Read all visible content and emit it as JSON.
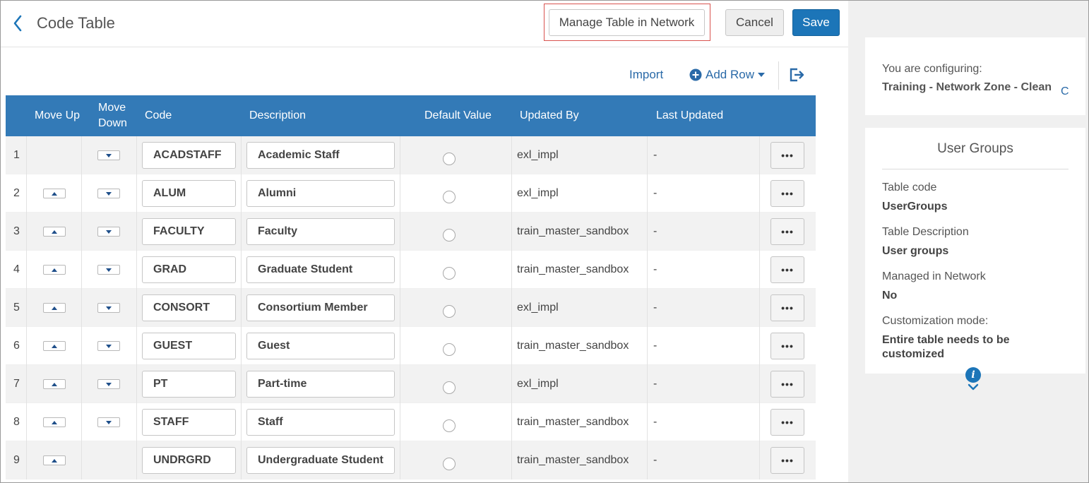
{
  "header": {
    "title": "Code Table",
    "manage_label": "Manage Table in Network",
    "cancel_label": "Cancel",
    "save_label": "Save"
  },
  "toolbar": {
    "import_label": "Import",
    "add_row_label": "Add Row"
  },
  "table": {
    "headers": {
      "move_up": "Move Up",
      "move_down_1": "Move",
      "move_down_2": "Down",
      "code": "Code",
      "description": "Description",
      "default_value": "Default Value",
      "updated_by": "Updated By",
      "last_updated": "Last Updated"
    },
    "rows": [
      {
        "num": "1",
        "code": "ACADSTAFF",
        "description": "Academic Staff",
        "updated_by": "exl_impl",
        "last_updated": "-",
        "up": false,
        "down": true
      },
      {
        "num": "2",
        "code": "ALUM",
        "description": "Alumni",
        "updated_by": "exl_impl",
        "last_updated": "-",
        "up": true,
        "down": true
      },
      {
        "num": "3",
        "code": "FACULTY",
        "description": "Faculty",
        "updated_by": "train_master_sandbox",
        "last_updated": "-",
        "up": true,
        "down": true
      },
      {
        "num": "4",
        "code": "GRAD",
        "description": "Graduate Student",
        "updated_by": "train_master_sandbox",
        "last_updated": "-",
        "up": true,
        "down": true
      },
      {
        "num": "5",
        "code": "CONSORT",
        "description": "Consortium Member",
        "updated_by": "exl_impl",
        "last_updated": "-",
        "up": true,
        "down": true
      },
      {
        "num": "6",
        "code": "GUEST",
        "description": "Guest",
        "updated_by": "train_master_sandbox",
        "last_updated": "-",
        "up": true,
        "down": true
      },
      {
        "num": "7",
        "code": "PT",
        "description": "Part-time",
        "updated_by": "exl_impl",
        "last_updated": "-",
        "up": true,
        "down": true
      },
      {
        "num": "8",
        "code": "STAFF",
        "description": "Staff",
        "updated_by": "train_master_sandbox",
        "last_updated": "-",
        "up": true,
        "down": true
      },
      {
        "num": "9",
        "code": "UNDRGRD",
        "description": "Undergraduate Student",
        "updated_by": "train_master_sandbox",
        "last_updated": "-",
        "up": true,
        "down": false
      }
    ],
    "more_label": "•••"
  },
  "side_panel": {
    "configuring_label": "You are configuring:",
    "configuring_value": "Training - Network Zone - Clean",
    "configuring_link": "C",
    "card_title": "User Groups",
    "fields": [
      {
        "label": "Table code",
        "value": "UserGroups"
      },
      {
        "label": "Table Description",
        "value": "User groups"
      },
      {
        "label": "Managed in Network",
        "value": "No"
      },
      {
        "label": "Customization mode:",
        "value": "Entire table needs to be customized"
      }
    ]
  },
  "icons": {
    "back": "chevron-left-icon",
    "add_row": "plus-circle-icon",
    "add_row_caret": "caret-down-icon",
    "export": "export-icon",
    "info": "info-icon",
    "expand": "chevron-down-icon"
  },
  "colors": {
    "header_blue": "#337ab7",
    "primary": "#1c75b8",
    "link": "#2a6aa8",
    "highlight_border": "#d9534f"
  }
}
